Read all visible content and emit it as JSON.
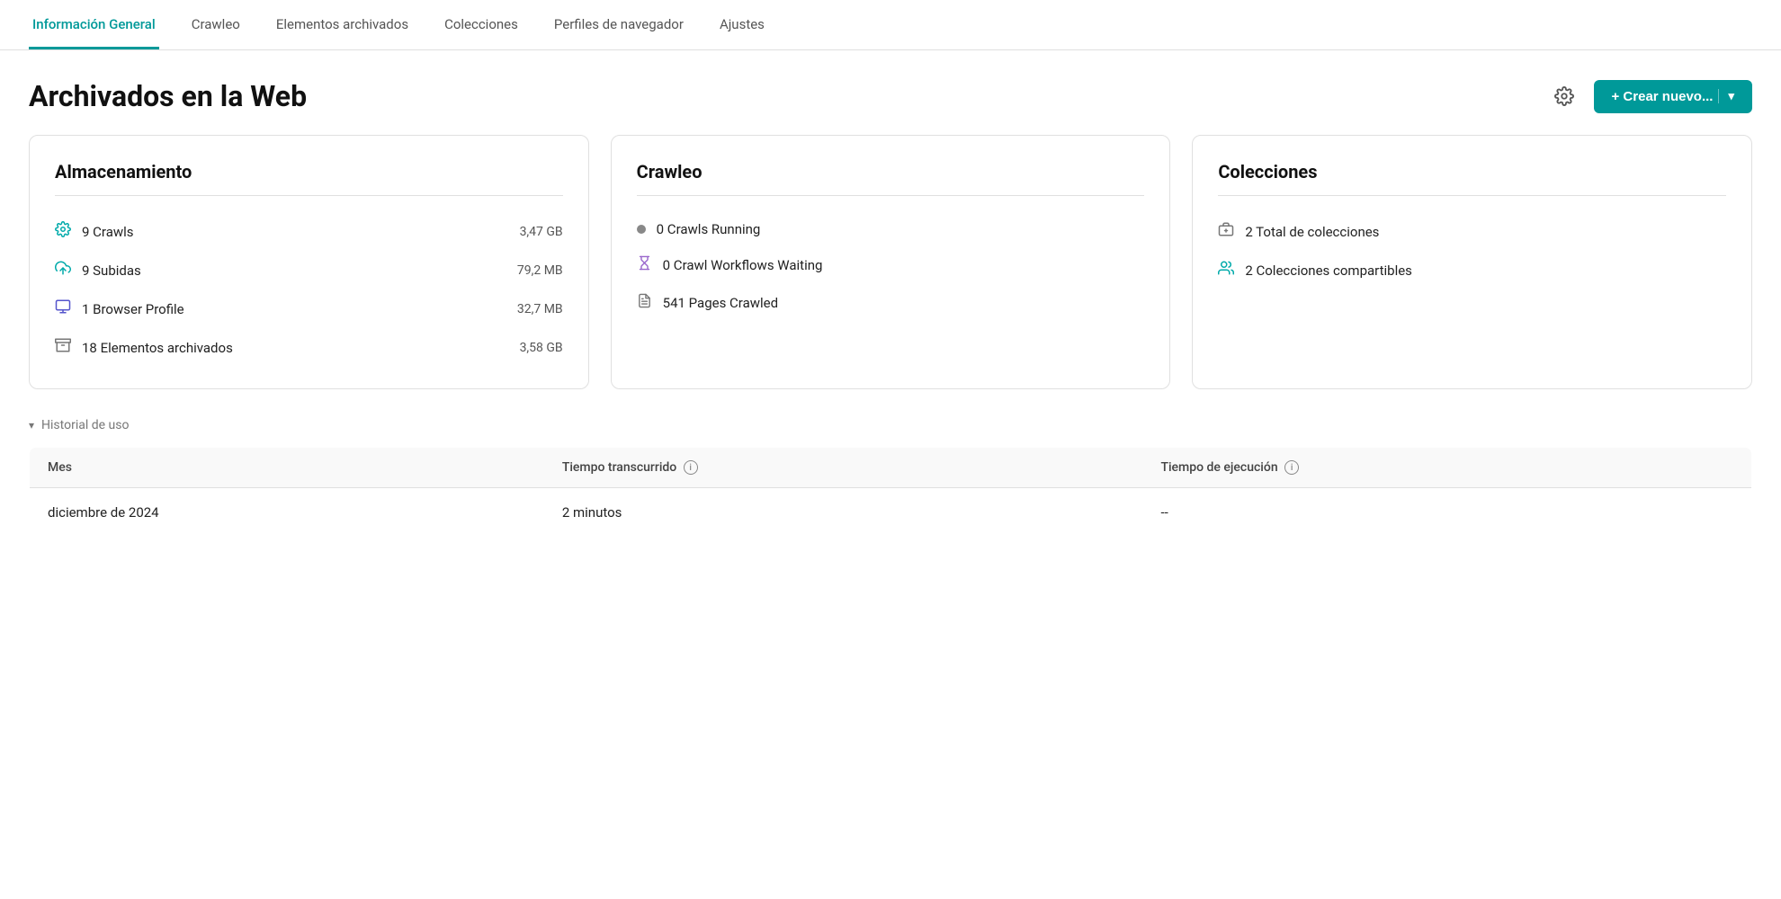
{
  "nav": {
    "tabs": [
      {
        "id": "general",
        "label": "Información General",
        "active": true
      },
      {
        "id": "crawleo",
        "label": "Crawleo",
        "active": false
      },
      {
        "id": "archived",
        "label": "Elementos archivados",
        "active": false
      },
      {
        "id": "collections",
        "label": "Colecciones",
        "active": false
      },
      {
        "id": "profiles",
        "label": "Perfiles de navegador",
        "active": false
      },
      {
        "id": "settings",
        "label": "Ajustes",
        "active": false
      }
    ]
  },
  "header": {
    "title": "Archivados en la Web",
    "create_button_label": "+ Crear nuevo...",
    "chevron_label": "▾"
  },
  "storage_card": {
    "title": "Almacenamiento",
    "items": [
      {
        "icon": "gear-icon",
        "label": "9 Crawls",
        "size": "3,47 GB"
      },
      {
        "icon": "upload-icon",
        "label": "9 Subidas",
        "size": "79,2 MB"
      },
      {
        "icon": "browser-icon",
        "label": "1 Browser Profile",
        "size": "32,7 MB"
      },
      {
        "icon": "archive-icon",
        "label": "18 Elementos archivados",
        "size": "3,58 GB"
      }
    ]
  },
  "crawleo_card": {
    "title": "Crawleo",
    "items": [
      {
        "icon": "dot-icon",
        "label": "0 Crawls Running"
      },
      {
        "icon": "hourglass-icon",
        "label": "0 Crawl Workflows Waiting"
      },
      {
        "icon": "pages-icon",
        "label": "541 Pages Crawled"
      }
    ]
  },
  "collections_card": {
    "title": "Colecciones",
    "items": [
      {
        "icon": "collection-icon",
        "label": "2 Total de colecciones"
      },
      {
        "icon": "shared-icon",
        "label": "2 Colecciones compartibles"
      }
    ]
  },
  "history": {
    "toggle_label": "Historial de uso",
    "columns": [
      {
        "id": "mes",
        "label": "Mes"
      },
      {
        "id": "tiempo_transcurrido",
        "label": "Tiempo transcurrido",
        "has_info": true
      },
      {
        "id": "tiempo_ejecucion",
        "label": "Tiempo de ejecución",
        "has_info": true
      }
    ],
    "rows": [
      {
        "mes": "diciembre de 2024",
        "tiempo_transcurrido": "2 minutos",
        "tiempo_ejecucion": "--"
      }
    ]
  }
}
